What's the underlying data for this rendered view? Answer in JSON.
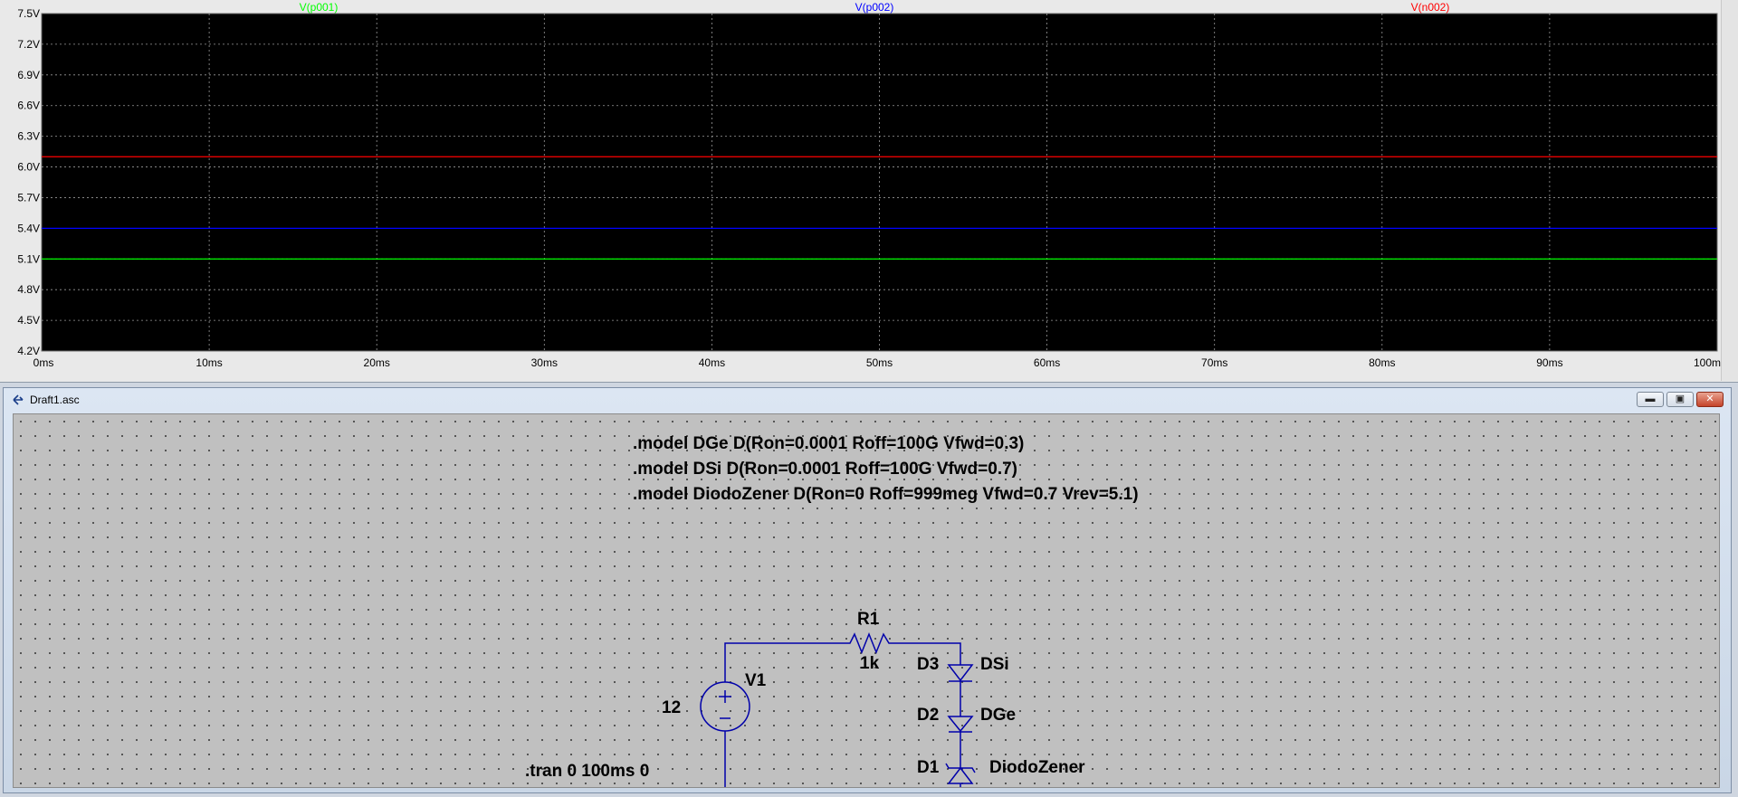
{
  "waveform": {
    "traces": [
      {
        "name": "V(p001)",
        "color": "#00ff00",
        "value": 5.1
      },
      {
        "name": "V(p002)",
        "color": "#0000ff",
        "value": 5.4
      },
      {
        "name": "V(n002)",
        "color": "#ff0000",
        "value": 6.1
      }
    ],
    "y_ticks": [
      "7.5V",
      "7.2V",
      "6.9V",
      "6.6V",
      "6.3V",
      "6.0V",
      "5.7V",
      "5.4V",
      "5.1V",
      "4.8V",
      "4.5V",
      "4.2V"
    ],
    "y_range": [
      4.2,
      7.5
    ],
    "x_ticks": [
      "0ms",
      "10ms",
      "20ms",
      "30ms",
      "40ms",
      "50ms",
      "60ms",
      "70ms",
      "80ms",
      "90ms",
      "100ms"
    ],
    "x_range_ms": [
      0,
      100
    ],
    "plot_background": "#000000",
    "grid_color": "#9a9a9a"
  },
  "window": {
    "title": "Draft1.asc",
    "minimize": "▬",
    "maximize": "▣",
    "close": "✕"
  },
  "schematic": {
    "directives": [
      ".model DGe D(Ron=0.0001 Roff=100G Vfwd=0.3)",
      ".model DSi D(Ron=0.0001 Roff=100G Vfwd=0.7)",
      ".model DiodoZener D(Ron=0 Roff=999meg Vfwd=0.7 Vrev=5.1)"
    ],
    "resistor": {
      "ref": "R1",
      "value": "1k"
    },
    "source": {
      "ref": "V1",
      "value": "12"
    },
    "diodes": [
      {
        "ref": "D3",
        "model": "DSi"
      },
      {
        "ref": "D2",
        "model": "DGe"
      },
      {
        "ref": "D1",
        "model": "DiodoZener"
      }
    ],
    "tran": ".tran 0 100ms 0",
    "wire_color": "#0000aa"
  }
}
